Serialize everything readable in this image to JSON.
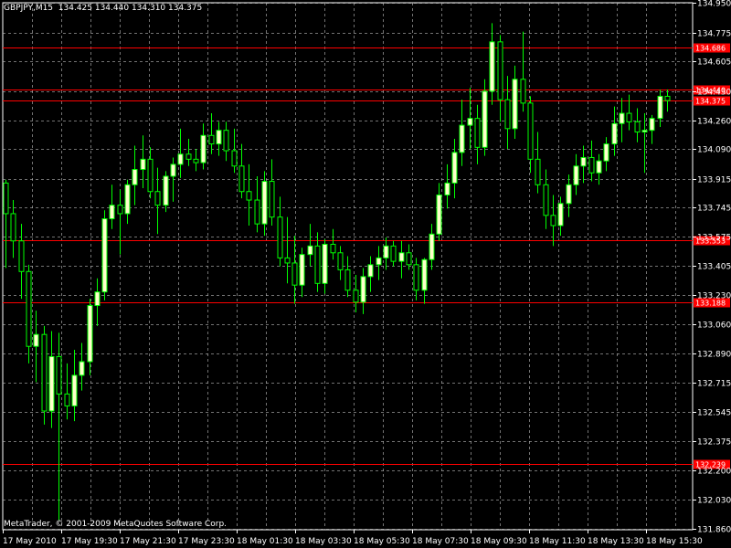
{
  "header": {
    "symbol": "GBPJPY,M15",
    "ohlc": "134.425 134.440 134.310 134.375"
  },
  "footer": {
    "copyright": "MetaTrader, © 2001-2009 MetaQuotes Software Corp."
  },
  "colors": {
    "background": "#000000",
    "grid": "#c0c0c0",
    "bull_body": "#ffffcc",
    "bear_body": "#000000",
    "candle_outline": "#00ff00",
    "level_line": "#ff0000",
    "level_label_bg": "#ff0000",
    "axis_text": "#ffffff"
  },
  "chart_data": {
    "type": "candlestick",
    "ylim": [
      131.852,
      134.95
    ],
    "y_ticks": [
      "134.950",
      "134.775",
      "134.605",
      "134.430",
      "134.260",
      "134.090",
      "133.915",
      "133.745",
      "133.575",
      "133.405",
      "133.230",
      "133.060",
      "132.890",
      "132.715",
      "132.545",
      "132.375",
      "132.200",
      "132.030",
      "131.860"
    ],
    "x_ticks": [
      "17 May 2010",
      "17 May 19:30",
      "17 May 21:30",
      "17 May 23:30",
      "18 May 01:30",
      "18 May 03:30",
      "18 May 05:30",
      "18 May 07:30",
      "18 May 09:30",
      "18 May 11:30",
      "18 May 13:30",
      "18 May 15:30"
    ],
    "levels": [
      {
        "value": 134.686,
        "label": "134.686"
      },
      {
        "value": 134.44,
        "label": "134.440"
      },
      {
        "value": 134.375,
        "label": "134.375"
      },
      {
        "value": 133.553,
        "label": "133.553"
      },
      {
        "value": 133.188,
        "label": "133.188"
      },
      {
        "value": 132.239,
        "label": "132.239"
      }
    ],
    "candles": [
      [
        133.89,
        133.91,
        133.39,
        133.71
      ],
      [
        133.71,
        133.79,
        133.45,
        133.55
      ],
      [
        133.55,
        133.65,
        133.21,
        133.37
      ],
      [
        133.37,
        133.41,
        132.83,
        132.93
      ],
      [
        132.93,
        133.14,
        132.72,
        133.0
      ],
      [
        133.0,
        133.05,
        132.47,
        132.55
      ],
      [
        132.55,
        133.02,
        132.45,
        132.87
      ],
      [
        132.87,
        133.01,
        131.91,
        132.65
      ],
      [
        132.65,
        132.83,
        132.5,
        132.58
      ],
      [
        132.58,
        132.91,
        132.49,
        132.76
      ],
      [
        132.76,
        132.95,
        132.67,
        132.84
      ],
      [
        132.84,
        133.21,
        132.76,
        133.17
      ],
      [
        133.17,
        133.33,
        133.05,
        133.25
      ],
      [
        133.25,
        133.73,
        133.2,
        133.68
      ],
      [
        133.68,
        133.88,
        133.62,
        133.76
      ],
      [
        133.76,
        133.85,
        133.47,
        133.71
      ],
      [
        133.71,
        133.91,
        133.65,
        133.88
      ],
      [
        133.88,
        134.11,
        133.76,
        133.97
      ],
      [
        133.97,
        134.17,
        133.86,
        134.03
      ],
      [
        134.03,
        134.1,
        133.8,
        133.84
      ],
      [
        133.84,
        133.98,
        133.59,
        133.76
      ],
      [
        133.76,
        133.96,
        133.72,
        133.93
      ],
      [
        133.93,
        134.04,
        133.78,
        134.0
      ],
      [
        134.0,
        134.21,
        133.92,
        134.06
      ],
      [
        134.06,
        134.15,
        133.99,
        134.03
      ],
      [
        134.03,
        134.09,
        133.96,
        134.01
      ],
      [
        134.01,
        134.24,
        133.97,
        134.17
      ],
      [
        134.17,
        134.3,
        134.06,
        134.12
      ],
      [
        134.12,
        134.25,
        134.05,
        134.2
      ],
      [
        134.2,
        134.25,
        134.02,
        134.08
      ],
      [
        134.08,
        134.21,
        133.95,
        133.99
      ],
      [
        133.99,
        134.12,
        133.8,
        133.84
      ],
      [
        133.84,
        134.0,
        133.64,
        133.79
      ],
      [
        133.79,
        133.93,
        133.6,
        133.65
      ],
      [
        133.65,
        133.96,
        133.58,
        133.9
      ],
      [
        133.9,
        134.03,
        133.64,
        133.69
      ],
      [
        133.69,
        133.81,
        133.4,
        133.45
      ],
      [
        133.45,
        133.69,
        133.3,
        133.42
      ],
      [
        133.42,
        133.58,
        133.18,
        133.29
      ],
      [
        133.29,
        133.51,
        133.22,
        133.47
      ],
      [
        133.47,
        133.65,
        133.4,
        133.52
      ],
      [
        133.52,
        133.6,
        133.25,
        133.3
      ],
      [
        133.3,
        133.56,
        133.24,
        133.53
      ],
      [
        133.53,
        133.62,
        133.44,
        133.48
      ],
      [
        133.48,
        133.52,
        133.32,
        133.38
      ],
      [
        133.38,
        133.46,
        133.22,
        133.26
      ],
      [
        133.26,
        133.35,
        133.13,
        133.19
      ],
      [
        133.19,
        133.39,
        133.12,
        133.34
      ],
      [
        133.34,
        133.46,
        133.25,
        133.41
      ],
      [
        133.41,
        133.52,
        133.32,
        133.45
      ],
      [
        133.45,
        133.57,
        133.38,
        133.52
      ],
      [
        133.52,
        133.55,
        133.4,
        133.43
      ],
      [
        133.43,
        133.55,
        133.33,
        133.48
      ],
      [
        133.48,
        133.53,
        133.38,
        133.41
      ],
      [
        133.41,
        133.45,
        133.2,
        133.26
      ],
      [
        133.26,
        133.45,
        133.18,
        133.44
      ],
      [
        133.44,
        133.65,
        133.38,
        133.59
      ],
      [
        133.59,
        133.89,
        133.55,
        133.82
      ],
      [
        133.82,
        134.0,
        133.74,
        133.89
      ],
      [
        133.89,
        134.15,
        133.8,
        134.07
      ],
      [
        134.07,
        134.38,
        133.99,
        134.23
      ],
      [
        134.23,
        134.45,
        134.09,
        134.27
      ],
      [
        134.27,
        134.35,
        134.0,
        134.1
      ],
      [
        134.1,
        134.5,
        134.05,
        134.43
      ],
      [
        134.43,
        134.83,
        134.35,
        134.72
      ],
      [
        134.72,
        134.76,
        134.25,
        134.38
      ],
      [
        134.38,
        134.52,
        134.09,
        134.21
      ],
      [
        134.21,
        134.58,
        134.15,
        134.5
      ],
      [
        134.5,
        134.78,
        134.31,
        134.36
      ],
      [
        134.36,
        134.4,
        133.95,
        134.03
      ],
      [
        134.03,
        134.19,
        133.83,
        133.88
      ],
      [
        133.88,
        133.97,
        133.62,
        133.7
      ],
      [
        133.7,
        133.82,
        133.52,
        133.64
      ],
      [
        133.64,
        133.81,
        133.58,
        133.77
      ],
      [
        133.77,
        133.94,
        133.69,
        133.88
      ],
      [
        133.88,
        134.06,
        133.82,
        133.99
      ],
      [
        133.99,
        134.11,
        133.89,
        134.04
      ],
      [
        134.04,
        134.14,
        133.9,
        133.95
      ],
      [
        133.95,
        134.06,
        133.88,
        134.02
      ],
      [
        134.02,
        134.16,
        133.96,
        134.12
      ],
      [
        134.12,
        134.34,
        134.05,
        134.24
      ],
      [
        134.24,
        134.39,
        134.13,
        134.3
      ],
      [
        134.3,
        134.41,
        134.2,
        134.25
      ],
      [
        134.25,
        134.33,
        134.13,
        134.19
      ],
      [
        134.19,
        134.3,
        133.95,
        134.2
      ],
      [
        134.2,
        134.29,
        134.12,
        134.27
      ],
      [
        134.27,
        134.44,
        134.22,
        134.4
      ],
      [
        134.4,
        134.44,
        134.31,
        134.375
      ]
    ]
  }
}
